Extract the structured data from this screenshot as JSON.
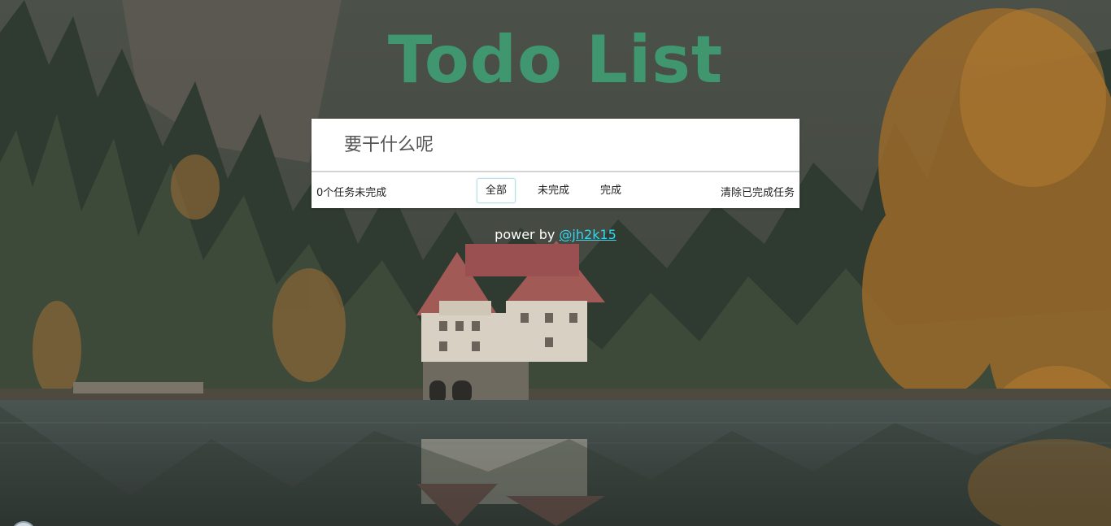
{
  "app": {
    "title": "Todo List"
  },
  "input": {
    "placeholder": "要干什么呢",
    "value": ""
  },
  "helper": {
    "left_count": "0个任务未完成",
    "tabs": [
      {
        "label": "全部",
        "active": true
      },
      {
        "label": "未完成",
        "active": false
      },
      {
        "label": "完成",
        "active": false
      }
    ],
    "clear_completed": "清除已完成任务"
  },
  "footer": {
    "text": "power by ",
    "author_link": "@jh2k15"
  },
  "colors": {
    "title": "#3eaa7a",
    "link": "#2fd9f0",
    "panel_bg": "#ffffff"
  }
}
